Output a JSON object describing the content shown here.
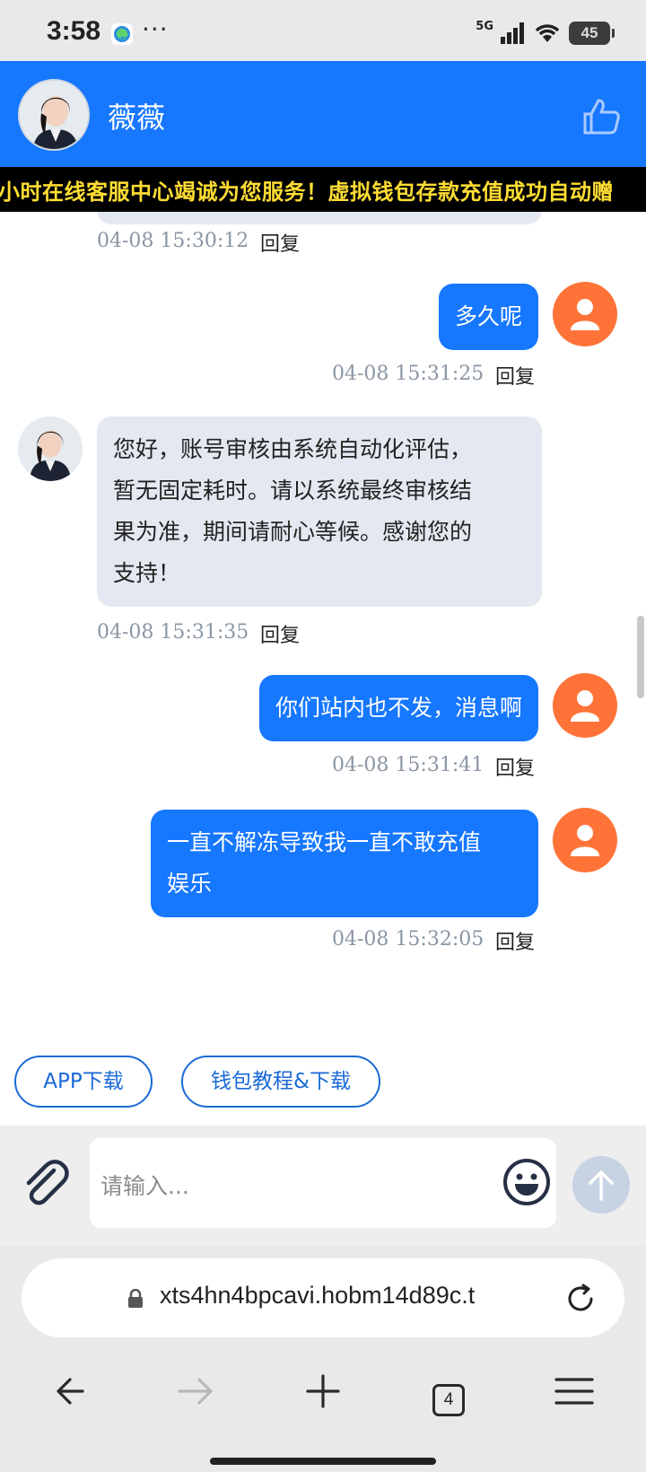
{
  "status_bar": {
    "time": "3:58",
    "more": "···",
    "network": "5G",
    "battery": "45",
    "icons": [
      "edge-browser-icon",
      "signal-icon",
      "wifi-icon",
      "battery-icon"
    ]
  },
  "header": {
    "agent_name": "薇薇",
    "like_icon": "thumbs-up-icon",
    "bg_color": "#1677ff"
  },
  "marquee": {
    "text": "小时在线客服中心竭诚为您服务！虚拟钱包存款充值成功自动赠"
  },
  "messages": [
    {
      "from": "agent",
      "text": "",
      "time": "04-08 15:30:12",
      "reply": "回复"
    },
    {
      "from": "user",
      "text": "多久呢",
      "time": "04-08 15:31:25",
      "reply": "回复"
    },
    {
      "from": "agent",
      "lines": [
        "您好，账号审核由系统自动化评估，",
        "暂无固定耗时。请以系统最终审核结",
        "果为准，期间请耐心等候。感谢您的",
        "支持！"
      ],
      "time": "04-08 15:31:35",
      "reply": "回复"
    },
    {
      "from": "user",
      "text": "你们站内也不发，消息啊",
      "time": "04-08 15:31:41",
      "reply": "回复"
    },
    {
      "from": "user",
      "lines": [
        "一直不解冻导致我一直不敢充值",
        "娱乐"
      ],
      "time": "04-08 15:32:05",
      "reply": "回复"
    }
  ],
  "quick_buttons": [
    {
      "label": "APP下载"
    },
    {
      "label": "钱包教程&下载"
    }
  ],
  "input": {
    "placeholder": "请输入...",
    "value": ""
  },
  "browser": {
    "url": "xts4hn4bpcavi.hobm14d89c.t",
    "tab_count": "4"
  },
  "colors": {
    "accent": "#1677ff",
    "user_avatar": "#ff7338",
    "agent_bubble": "#e4e9f1",
    "marquee_text": "#ffdd33"
  }
}
